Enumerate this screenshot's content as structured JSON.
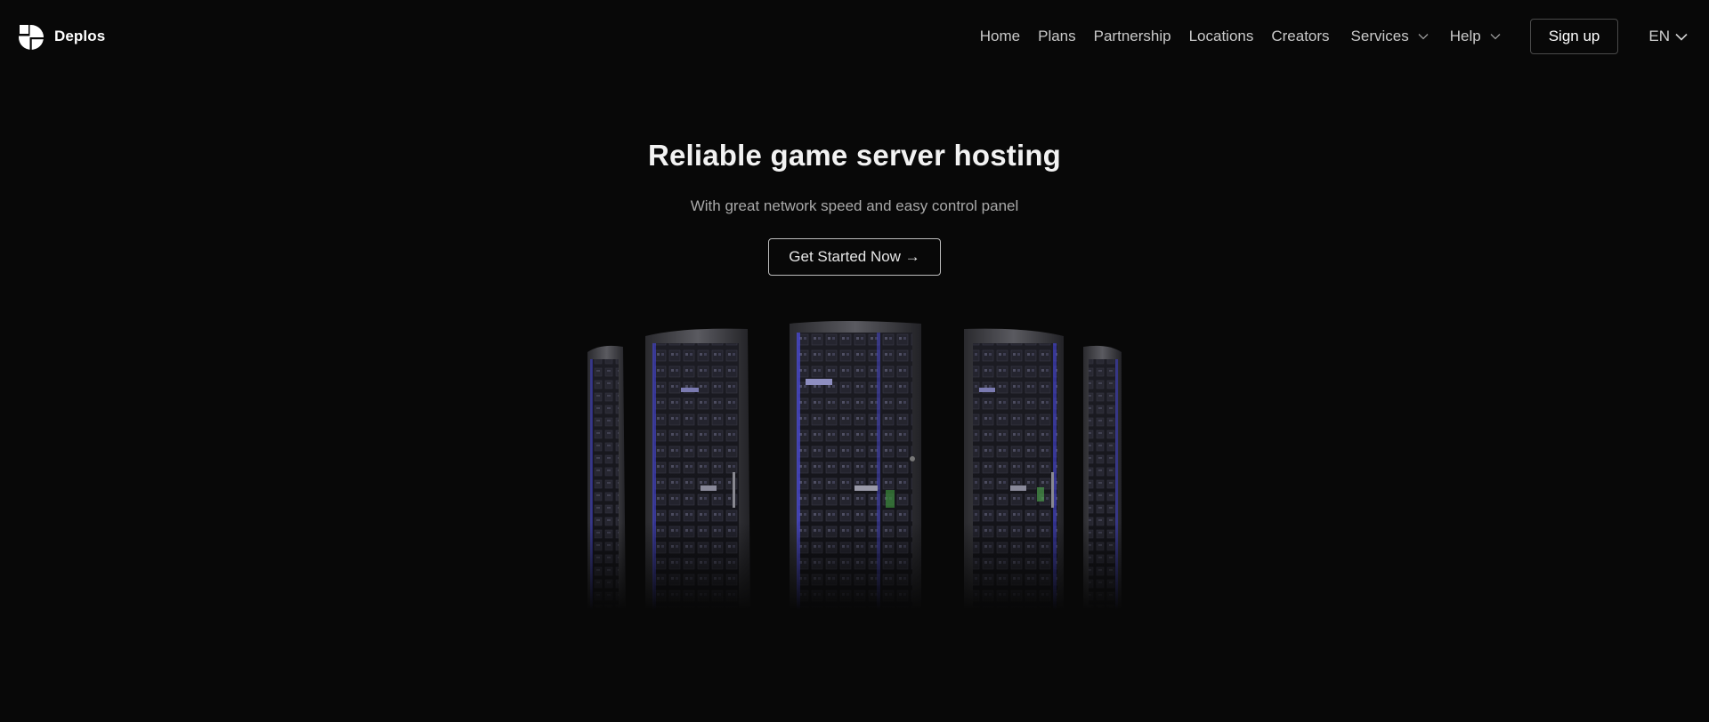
{
  "brand": {
    "name": "Deplos",
    "logo_icon": "deplos-logo-icon"
  },
  "nav": {
    "items": [
      {
        "label": "Home"
      },
      {
        "label": "Plans"
      },
      {
        "label": "Partnership"
      },
      {
        "label": "Locations"
      },
      {
        "label": "Creators"
      }
    ],
    "services_label": "Services",
    "help_label": "Help",
    "signup_label": "Sign up",
    "language": "EN"
  },
  "hero": {
    "title": "Reliable game server hosting",
    "subtitle": "With great network speed and easy control panel",
    "cta_label": "Get Started Now →",
    "image": "server-racks-image"
  },
  "colors": {
    "background": "#080808",
    "rack_glow": "#4a4ad8"
  }
}
